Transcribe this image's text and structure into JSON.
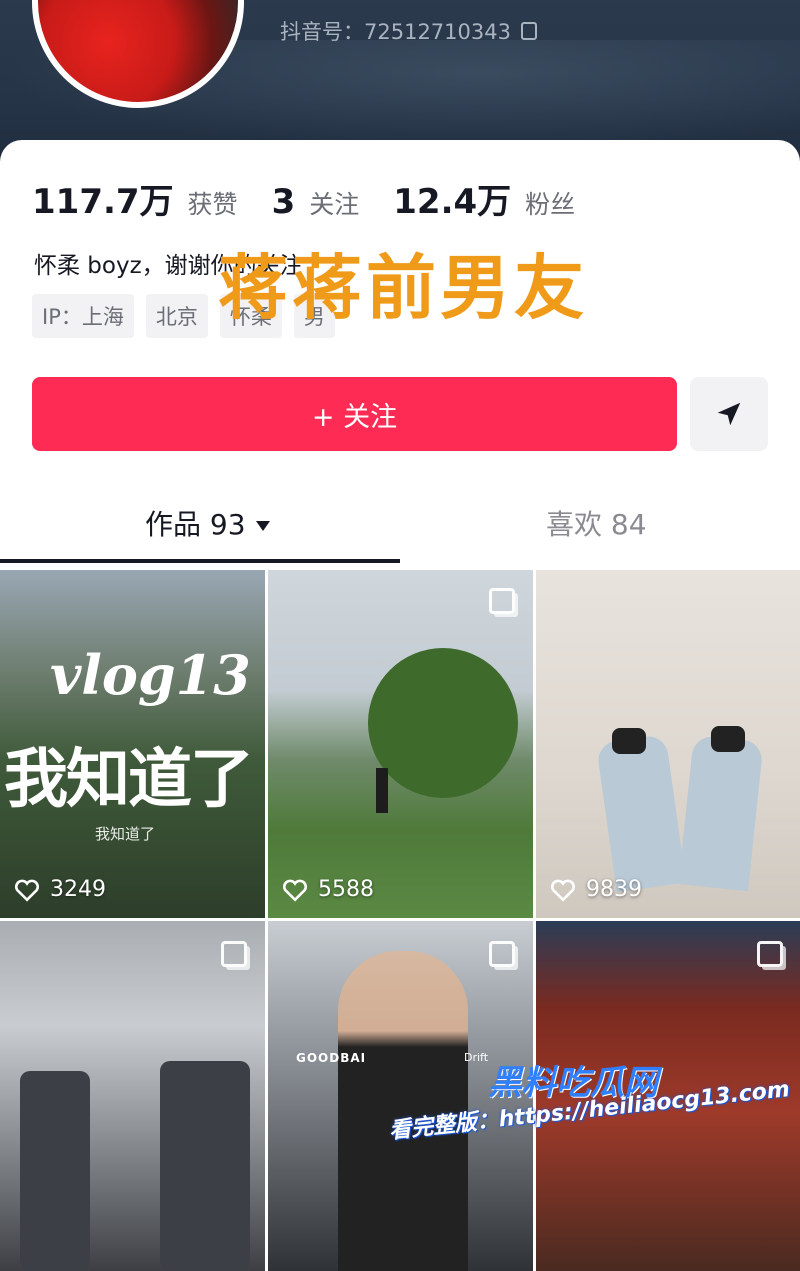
{
  "profile": {
    "douyin_id_label": "抖音号：72512710343",
    "stats": [
      {
        "value": "117.7万",
        "label": "获赞"
      },
      {
        "value": "3",
        "label": "关注"
      },
      {
        "value": "12.4万",
        "label": "粉丝"
      }
    ],
    "bio": "怀柔 boyz，谢谢你的关注",
    "tags": [
      "IP：上海",
      "北京",
      "怀柔",
      "男"
    ]
  },
  "overlay_title": "蒋蒋前男友",
  "actions": {
    "follow_label": "+ 关注",
    "share_icon": "send-icon"
  },
  "tabs": {
    "works": "作品 93",
    "likes": "喜欢 84"
  },
  "videos": [
    {
      "likes": "3249",
      "overlay_en": "vlog13",
      "overlay_cn": "我知道了",
      "overlay_sub": "我知道了",
      "multi": false
    },
    {
      "likes": "5588",
      "multi": true
    },
    {
      "likes": "9839",
      "multi": false
    },
    {
      "likes": "",
      "multi": true
    },
    {
      "likes": "",
      "multi": true,
      "poster_left": "GOODBAI",
      "poster_right": "Drift"
    },
    {
      "likes": "",
      "multi": true
    }
  ],
  "watermark": {
    "site_name": "黑料吃瓜网",
    "url_line": "看完整版：https://heiliaocg13.com"
  },
  "colors": {
    "follow": "#fe2c55",
    "overlay_title": "#f09a1a",
    "header": "#253447"
  }
}
